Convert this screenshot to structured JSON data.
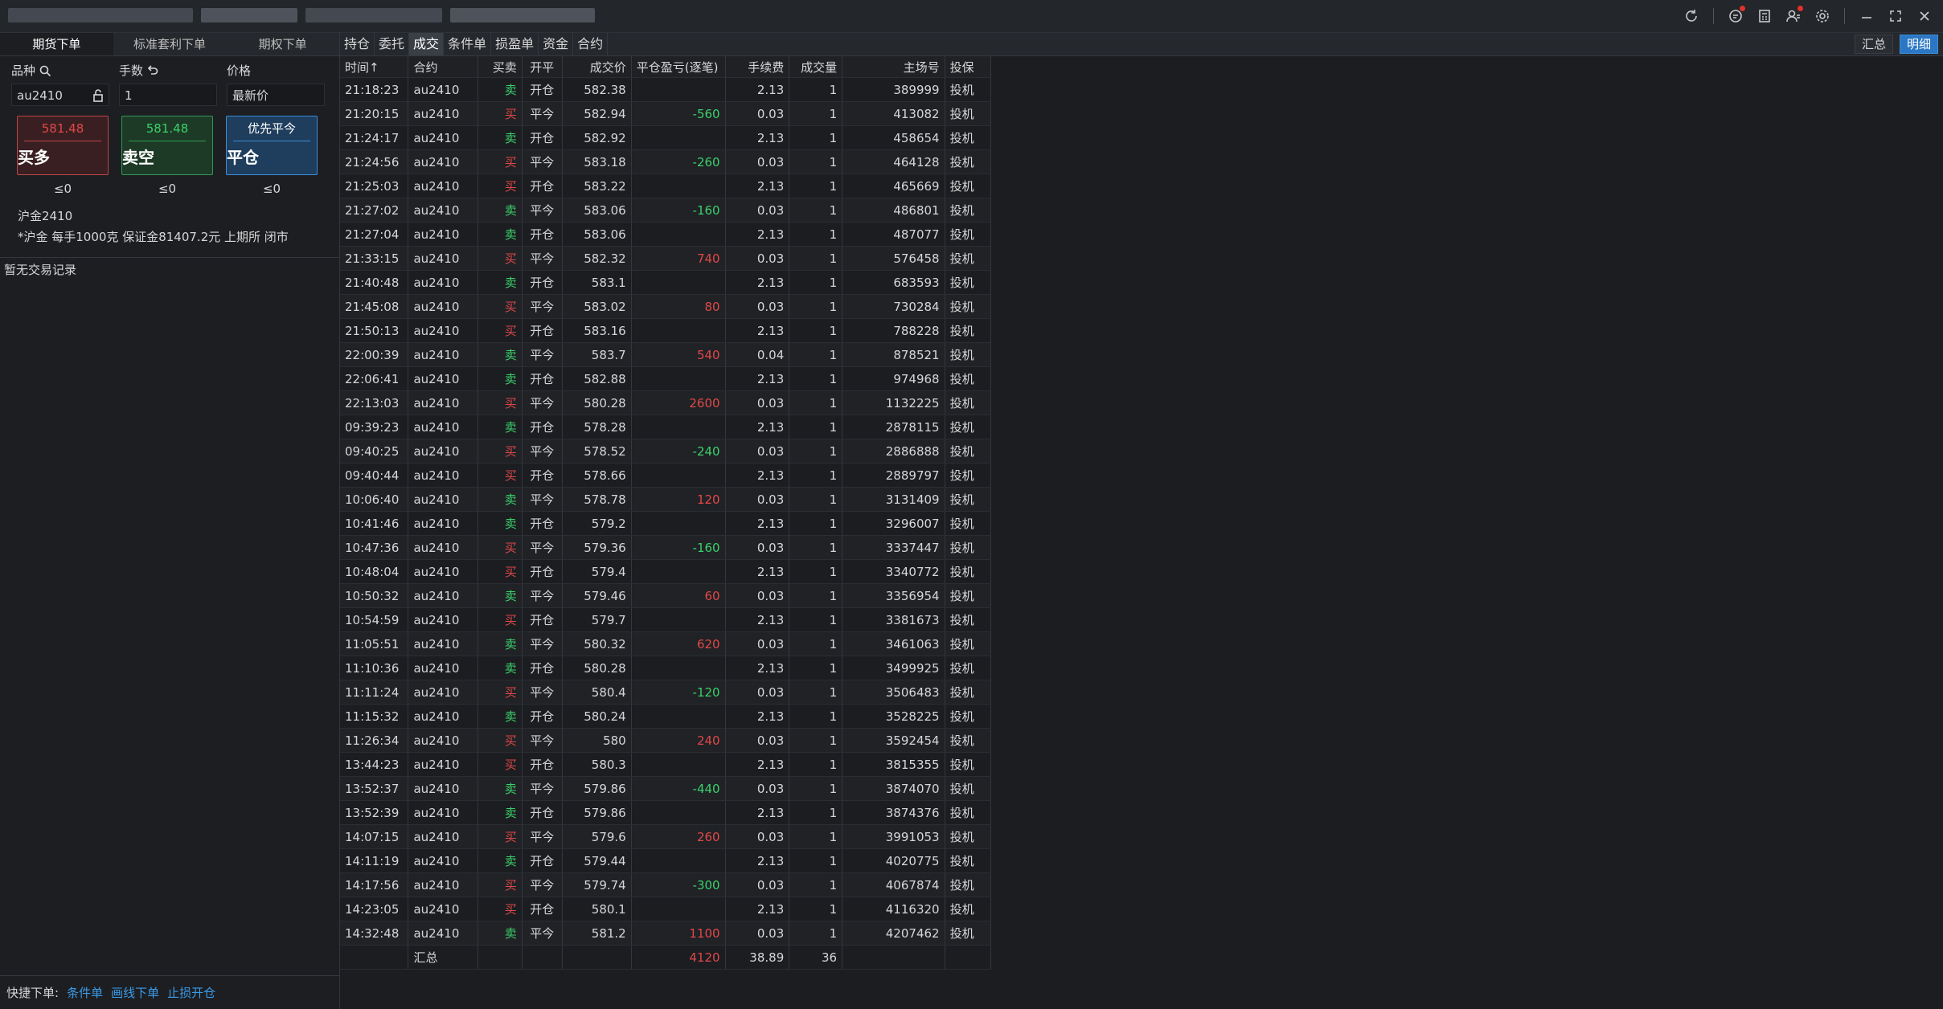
{
  "titlebar": {
    "actions": [
      "refresh-icon",
      "message-icon",
      "calculator-icon",
      "user-icon",
      "settings-icon",
      "minimize-icon",
      "maximize-icon",
      "close-icon"
    ]
  },
  "left": {
    "tabs": [
      "期货下单",
      "标准套利下单",
      "期权下单"
    ],
    "labels": {
      "symbol": "品种",
      "lots": "手数",
      "price": "价格"
    },
    "inputs": {
      "symbol": "au2410",
      "lots": "1",
      "price": "最新价"
    },
    "buttons": {
      "buy": {
        "price": "581.48",
        "label": "买多",
        "limit": "≤0"
      },
      "sell": {
        "price": "581.48",
        "label": "卖空",
        "limit": "≤0"
      },
      "close": {
        "price": "优先平今",
        "label": "平仓",
        "limit": "≤0"
      }
    },
    "contract_name": "沪金2410",
    "contract_desc": "*沪金 每手1000克 保证金81407.2元 上期所 闭市",
    "no_records": "暂无交易记录",
    "quick": {
      "label": "快捷下单:",
      "links": [
        "条件单",
        "画线下单",
        "止损开仓"
      ]
    }
  },
  "right": {
    "tabs": [
      "持仓",
      "委托",
      "成交",
      "条件单",
      "损盈单",
      "资金",
      "合约"
    ],
    "active_tab": "成交",
    "view_buttons": [
      "汇总",
      "明细"
    ],
    "columns": [
      "时间↑",
      "合约",
      "买卖",
      "开平",
      "成交价",
      "平仓盈亏(逐笔)",
      "手续费",
      "成交量",
      "主场号",
      "投保"
    ],
    "rows": [
      [
        "21:18:23",
        "au2410",
        "卖",
        "开仓",
        "582.38",
        "",
        "2.13",
        "1",
        "389999",
        "投机"
      ],
      [
        "21:20:15",
        "au2410",
        "买",
        "平今",
        "582.94",
        "-560",
        "0.03",
        "1",
        "413082",
        "投机"
      ],
      [
        "21:24:17",
        "au2410",
        "卖",
        "开仓",
        "582.92",
        "",
        "2.13",
        "1",
        "458654",
        "投机"
      ],
      [
        "21:24:56",
        "au2410",
        "买",
        "平今",
        "583.18",
        "-260",
        "0.03",
        "1",
        "464128",
        "投机"
      ],
      [
        "21:25:03",
        "au2410",
        "买",
        "开仓",
        "583.22",
        "",
        "2.13",
        "1",
        "465669",
        "投机"
      ],
      [
        "21:27:02",
        "au2410",
        "卖",
        "平今",
        "583.06",
        "-160",
        "0.03",
        "1",
        "486801",
        "投机"
      ],
      [
        "21:27:04",
        "au2410",
        "卖",
        "开仓",
        "583.06",
        "",
        "2.13",
        "1",
        "487077",
        "投机"
      ],
      [
        "21:33:15",
        "au2410",
        "买",
        "平今",
        "582.32",
        "740",
        "0.03",
        "1",
        "576458",
        "投机"
      ],
      [
        "21:40:48",
        "au2410",
        "卖",
        "开仓",
        "583.1",
        "",
        "2.13",
        "1",
        "683593",
        "投机"
      ],
      [
        "21:45:08",
        "au2410",
        "买",
        "平今",
        "583.02",
        "80",
        "0.03",
        "1",
        "730284",
        "投机"
      ],
      [
        "21:50:13",
        "au2410",
        "买",
        "开仓",
        "583.16",
        "",
        "2.13",
        "1",
        "788228",
        "投机"
      ],
      [
        "22:00:39",
        "au2410",
        "卖",
        "平今",
        "583.7",
        "540",
        "0.04",
        "1",
        "878521",
        "投机"
      ],
      [
        "22:06:41",
        "au2410",
        "卖",
        "开仓",
        "582.88",
        "",
        "2.13",
        "1",
        "974968",
        "投机"
      ],
      [
        "22:13:03",
        "au2410",
        "买",
        "平今",
        "580.28",
        "2600",
        "0.03",
        "1",
        "1132225",
        "投机"
      ],
      [
        "09:39:23",
        "au2410",
        "卖",
        "开仓",
        "578.28",
        "",
        "2.13",
        "1",
        "2878115",
        "投机"
      ],
      [
        "09:40:25",
        "au2410",
        "买",
        "平今",
        "578.52",
        "-240",
        "0.03",
        "1",
        "2886888",
        "投机"
      ],
      [
        "09:40:44",
        "au2410",
        "买",
        "开仓",
        "578.66",
        "",
        "2.13",
        "1",
        "2889797",
        "投机"
      ],
      [
        "10:06:40",
        "au2410",
        "卖",
        "平今",
        "578.78",
        "120",
        "0.03",
        "1",
        "3131409",
        "投机"
      ],
      [
        "10:41:46",
        "au2410",
        "卖",
        "开仓",
        "579.2",
        "",
        "2.13",
        "1",
        "3296007",
        "投机"
      ],
      [
        "10:47:36",
        "au2410",
        "买",
        "平今",
        "579.36",
        "-160",
        "0.03",
        "1",
        "3337447",
        "投机"
      ],
      [
        "10:48:04",
        "au2410",
        "买",
        "开仓",
        "579.4",
        "",
        "2.13",
        "1",
        "3340772",
        "投机"
      ],
      [
        "10:50:32",
        "au2410",
        "卖",
        "平今",
        "579.46",
        "60",
        "0.03",
        "1",
        "3356954",
        "投机"
      ],
      [
        "10:54:59",
        "au2410",
        "买",
        "开仓",
        "579.7",
        "",
        "2.13",
        "1",
        "3381673",
        "投机"
      ],
      [
        "11:05:51",
        "au2410",
        "卖",
        "平今",
        "580.32",
        "620",
        "0.03",
        "1",
        "3461063",
        "投机"
      ],
      [
        "11:10:36",
        "au2410",
        "卖",
        "开仓",
        "580.28",
        "",
        "2.13",
        "1",
        "3499925",
        "投机"
      ],
      [
        "11:11:24",
        "au2410",
        "买",
        "平今",
        "580.4",
        "-120",
        "0.03",
        "1",
        "3506483",
        "投机"
      ],
      [
        "11:15:32",
        "au2410",
        "卖",
        "开仓",
        "580.24",
        "",
        "2.13",
        "1",
        "3528225",
        "投机"
      ],
      [
        "11:26:34",
        "au2410",
        "买",
        "平今",
        "580",
        "240",
        "0.03",
        "1",
        "3592454",
        "投机"
      ],
      [
        "13:44:23",
        "au2410",
        "买",
        "开仓",
        "580.3",
        "",
        "2.13",
        "1",
        "3815355",
        "投机"
      ],
      [
        "13:52:37",
        "au2410",
        "卖",
        "平今",
        "579.86",
        "-440",
        "0.03",
        "1",
        "3874070",
        "投机"
      ],
      [
        "13:52:39",
        "au2410",
        "卖",
        "开仓",
        "579.86",
        "",
        "2.13",
        "1",
        "3874376",
        "投机"
      ],
      [
        "14:07:15",
        "au2410",
        "买",
        "平今",
        "579.6",
        "260",
        "0.03",
        "1",
        "3991053",
        "投机"
      ],
      [
        "14:11:19",
        "au2410",
        "卖",
        "开仓",
        "579.44",
        "",
        "2.13",
        "1",
        "4020775",
        "投机"
      ],
      [
        "14:17:56",
        "au2410",
        "买",
        "平今",
        "579.74",
        "-300",
        "0.03",
        "1",
        "4067874",
        "投机"
      ],
      [
        "14:23:05",
        "au2410",
        "买",
        "开仓",
        "580.1",
        "",
        "2.13",
        "1",
        "4116320",
        "投机"
      ],
      [
        "14:32:48",
        "au2410",
        "卖",
        "平今",
        "581.2",
        "1100",
        "0.03",
        "1",
        "4207462",
        "投机"
      ]
    ],
    "summary": {
      "label": "汇总",
      "pnl": "4120",
      "fee": "38.89",
      "volume": "36"
    }
  },
  "colors": {
    "buy": "#e04848",
    "sell": "#3bd06a",
    "accent": "#2b77c4"
  }
}
